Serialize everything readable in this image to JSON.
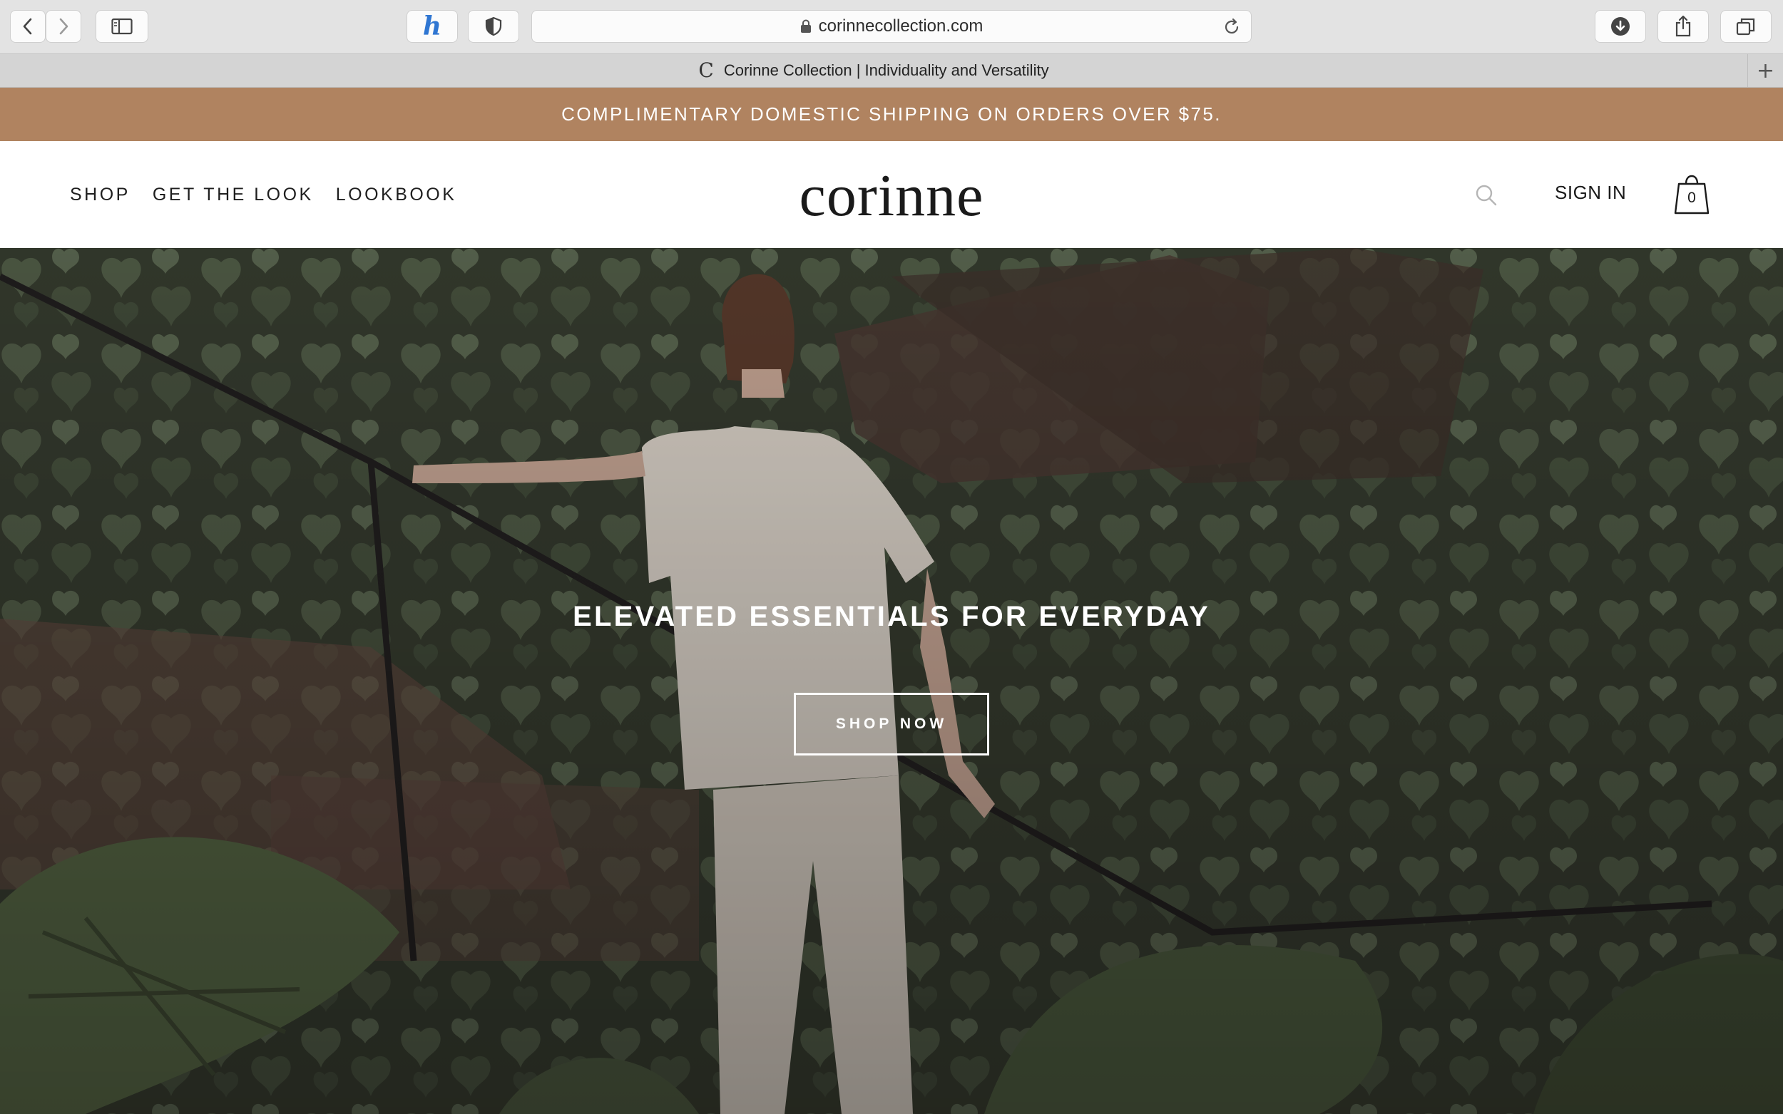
{
  "browser": {
    "url": "corinnecollection.com",
    "tab_title": "Corinne Collection | Individuality and Versatility",
    "tab_favicon": "C",
    "new_tab_symbol": "+",
    "extension_label": "h"
  },
  "promo": {
    "text": "COMPLIMENTARY DOMESTIC SHIPPING ON ORDERS OVER $75."
  },
  "header": {
    "nav": [
      {
        "label": "SHOP"
      },
      {
        "label": "GET THE LOOK"
      },
      {
        "label": "LOOKBOOK"
      }
    ],
    "logo": "corinne",
    "sign_in": "SIGN IN",
    "cart_count": "0"
  },
  "hero": {
    "heading": "ELEVATED ESSENTIALS FOR EVERYDAY",
    "cta_label": "SHOP NOW"
  },
  "colors": {
    "promo_bg": "#b08360",
    "chrome_bg": "#e3e3e3",
    "foliage_dark": "#2f3a2a",
    "foliage_mid": "#4b5a44",
    "garment": "#e9e3d8"
  },
  "icons": [
    "back-icon",
    "forward-icon",
    "sidebar-icon",
    "honey-extension-icon",
    "shield-icon",
    "lock-icon",
    "reload-icon",
    "download-icon",
    "share-icon",
    "tabs-icon",
    "search-icon",
    "shopping-bag-icon"
  ]
}
